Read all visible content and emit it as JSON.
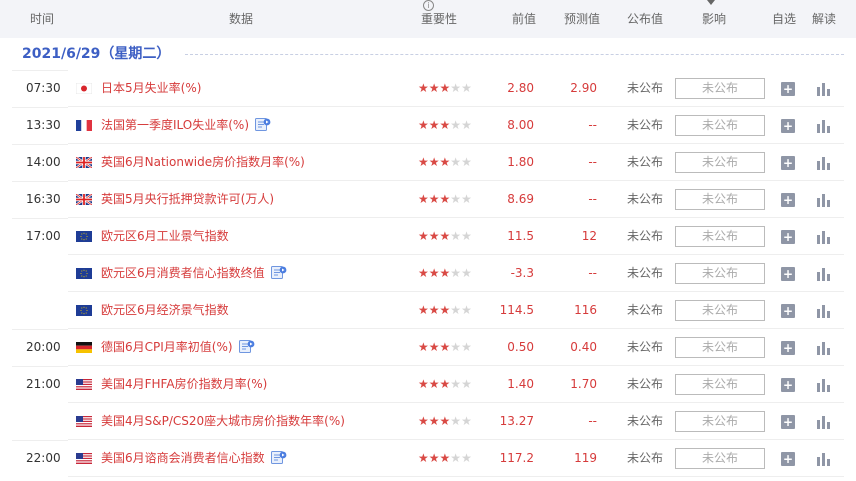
{
  "header": {
    "time": "时间",
    "data": "数据",
    "importance": "重要性",
    "previous": "前值",
    "forecast": "预测值",
    "published": "公布值",
    "impact": "影响",
    "watch": "自选",
    "explain": "解读"
  },
  "date_label": "2021/6/29（星期二）",
  "colors": {
    "accent": "#3d5fc4",
    "value_red": "#d63b3b",
    "star_on": "#d94a45"
  },
  "rows": [
    {
      "time": "07:30",
      "flag": "japan-flag-icon",
      "name": "日本5月失业率(%)",
      "doc": false,
      "stars": 3,
      "prev": "2.80",
      "forecast": "2.90",
      "published": "未公布",
      "impact": "未公布"
    },
    {
      "time": "13:30",
      "flag": "france-flag-icon",
      "name": "法国第一季度ILO失业率(%)",
      "doc": true,
      "stars": 3,
      "prev": "8.00",
      "forecast": "--",
      "published": "未公布",
      "impact": "未公布"
    },
    {
      "time": "14:00",
      "flag": "uk-flag-icon",
      "name": "英国6月Nationwide房价指数月率(%)",
      "doc": false,
      "stars": 3,
      "prev": "1.80",
      "forecast": "--",
      "published": "未公布",
      "impact": "未公布"
    },
    {
      "time": "16:30",
      "flag": "uk-flag-icon",
      "name": "英国5月央行抵押贷款许可(万人)",
      "doc": false,
      "stars": 3,
      "prev": "8.69",
      "forecast": "--",
      "published": "未公布",
      "impact": "未公布"
    },
    {
      "time": "17:00",
      "flag": "eu-flag-icon",
      "name": "欧元区6月工业景气指数",
      "doc": false,
      "stars": 3,
      "prev": "11.5",
      "forecast": "12",
      "published": "未公布",
      "impact": "未公布"
    },
    {
      "time": "",
      "flag": "eu-flag-icon",
      "name": "欧元区6月消费者信心指数终值",
      "doc": true,
      "stars": 3,
      "prev": "-3.3",
      "forecast": "--",
      "published": "未公布",
      "impact": "未公布"
    },
    {
      "time": "",
      "flag": "eu-flag-icon",
      "name": "欧元区6月经济景气指数",
      "doc": false,
      "stars": 3,
      "prev": "114.5",
      "forecast": "116",
      "published": "未公布",
      "impact": "未公布"
    },
    {
      "time": "20:00",
      "flag": "germany-flag-icon",
      "name": "德国6月CPI月率初值(%)",
      "doc": true,
      "stars": 3,
      "prev": "0.50",
      "forecast": "0.40",
      "published": "未公布",
      "impact": "未公布"
    },
    {
      "time": "21:00",
      "flag": "us-flag-icon",
      "name": "美国4月FHFA房价指数月率(%)",
      "doc": false,
      "stars": 3,
      "prev": "1.40",
      "forecast": "1.70",
      "published": "未公布",
      "impact": "未公布"
    },
    {
      "time": "",
      "flag": "us-flag-icon",
      "name": "美国4月S&P/CS20座大城市房价指数年率(%)",
      "doc": false,
      "stars": 3,
      "prev": "13.27",
      "forecast": "--",
      "published": "未公布",
      "impact": "未公布"
    },
    {
      "time": "22:00",
      "flag": "us-flag-icon",
      "name": "美国6月谘商会消费者信心指数",
      "doc": true,
      "stars": 3,
      "prev": "117.2",
      "forecast": "119",
      "published": "未公布",
      "impact": "未公布"
    }
  ]
}
